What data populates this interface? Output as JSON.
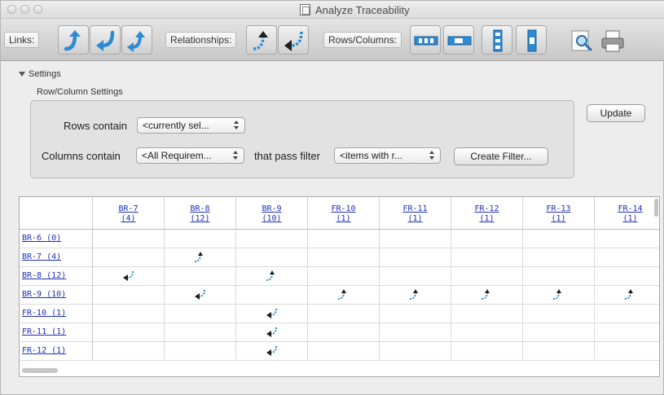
{
  "window": {
    "title": "Analyze Traceability"
  },
  "toolbar": {
    "links_label": "Links:",
    "relationships_label": "Relationships:",
    "rows_columns_label": "Rows/Columns:"
  },
  "settings": {
    "toggle_label": "Settings",
    "group_title": "Row/Column Settings",
    "rows_label": "Rows contain",
    "rows_value": "<currently sel...",
    "columns_label": "Columns contain",
    "columns_value": "<All Requirem...",
    "filter_label": "that pass filter",
    "filter_value": "<items with r...",
    "create_filter_label": "Create Filter...",
    "update_label": "Update"
  },
  "matrix": {
    "columns": [
      {
        "id": "BR-7",
        "count": "(4)"
      },
      {
        "id": "BR-8",
        "count": "(12)"
      },
      {
        "id": "BR-9",
        "count": "(10)"
      },
      {
        "id": "FR-10",
        "count": "(1)"
      },
      {
        "id": "FR-11",
        "count": "(1)"
      },
      {
        "id": "FR-12",
        "count": "(1)"
      },
      {
        "id": "FR-13",
        "count": "(1)"
      },
      {
        "id": "FR-14",
        "count": "(1)"
      }
    ],
    "rows": [
      {
        "label": "BR-6 (0)",
        "cells": [
          "",
          "",
          "",
          "",
          "",
          "",
          "",
          ""
        ]
      },
      {
        "label": "BR-7 (4)",
        "cells": [
          "",
          "up",
          "",
          "",
          "",
          "",
          "",
          ""
        ]
      },
      {
        "label": "BR-8 (12)",
        "cells": [
          "down",
          "",
          "up",
          "",
          "",
          "",
          "",
          ""
        ]
      },
      {
        "label": "BR-9 (10)",
        "cells": [
          "",
          "down",
          "",
          "up",
          "up",
          "up",
          "up",
          "up"
        ]
      },
      {
        "label": "FR-10 (1)",
        "cells": [
          "",
          "",
          "down",
          "",
          "",
          "",
          "",
          ""
        ]
      },
      {
        "label": "FR-11 (1)",
        "cells": [
          "",
          "",
          "down",
          "",
          "",
          "",
          "",
          ""
        ]
      },
      {
        "label": "FR-12 (1)",
        "cells": [
          "",
          "",
          "down",
          "",
          "",
          "",
          "",
          ""
        ]
      }
    ],
    "cell_icon_legend": {
      "up": "link-up-arrow-icon",
      "down": "link-down-arrow-icon"
    }
  },
  "colors": {
    "link_blue": "#1e2fb8",
    "arrow_blue": "#2f8fd6"
  }
}
